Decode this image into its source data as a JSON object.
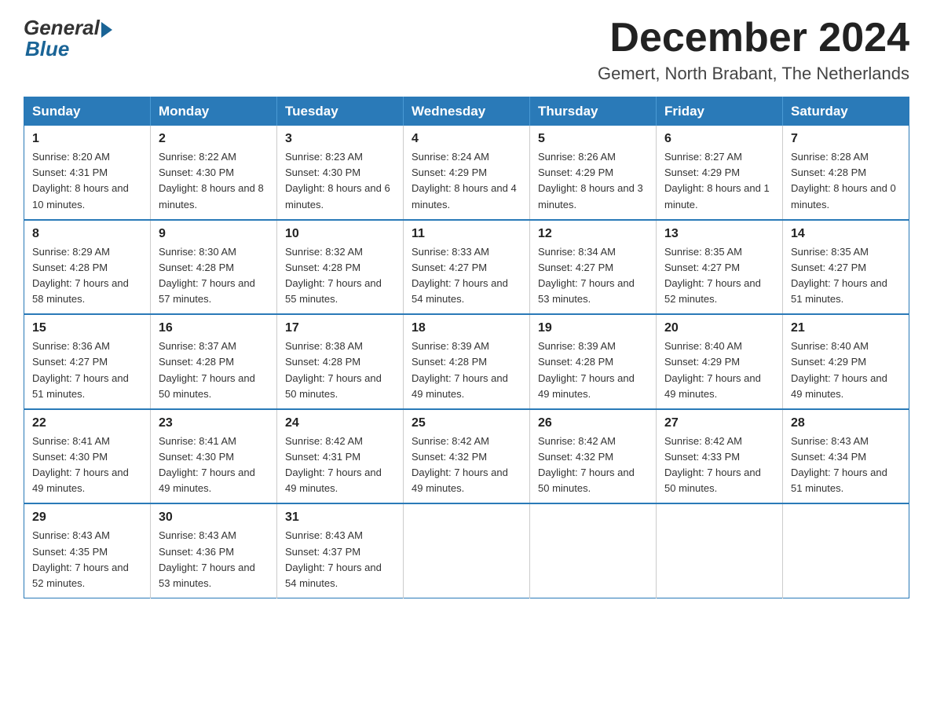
{
  "logo": {
    "general": "General",
    "blue": "Blue"
  },
  "header": {
    "month_year": "December 2024",
    "location": "Gemert, North Brabant, The Netherlands"
  },
  "weekdays": [
    "Sunday",
    "Monday",
    "Tuesday",
    "Wednesday",
    "Thursday",
    "Friday",
    "Saturday"
  ],
  "weeks": [
    [
      {
        "day": "1",
        "sunrise": "8:20 AM",
        "sunset": "4:31 PM",
        "daylight": "8 hours and 10 minutes."
      },
      {
        "day": "2",
        "sunrise": "8:22 AM",
        "sunset": "4:30 PM",
        "daylight": "8 hours and 8 minutes."
      },
      {
        "day": "3",
        "sunrise": "8:23 AM",
        "sunset": "4:30 PM",
        "daylight": "8 hours and 6 minutes."
      },
      {
        "day": "4",
        "sunrise": "8:24 AM",
        "sunset": "4:29 PM",
        "daylight": "8 hours and 4 minutes."
      },
      {
        "day": "5",
        "sunrise": "8:26 AM",
        "sunset": "4:29 PM",
        "daylight": "8 hours and 3 minutes."
      },
      {
        "day": "6",
        "sunrise": "8:27 AM",
        "sunset": "4:29 PM",
        "daylight": "8 hours and 1 minute."
      },
      {
        "day": "7",
        "sunrise": "8:28 AM",
        "sunset": "4:28 PM",
        "daylight": "8 hours and 0 minutes."
      }
    ],
    [
      {
        "day": "8",
        "sunrise": "8:29 AM",
        "sunset": "4:28 PM",
        "daylight": "7 hours and 58 minutes."
      },
      {
        "day": "9",
        "sunrise": "8:30 AM",
        "sunset": "4:28 PM",
        "daylight": "7 hours and 57 minutes."
      },
      {
        "day": "10",
        "sunrise": "8:32 AM",
        "sunset": "4:28 PM",
        "daylight": "7 hours and 55 minutes."
      },
      {
        "day": "11",
        "sunrise": "8:33 AM",
        "sunset": "4:27 PM",
        "daylight": "7 hours and 54 minutes."
      },
      {
        "day": "12",
        "sunrise": "8:34 AM",
        "sunset": "4:27 PM",
        "daylight": "7 hours and 53 minutes."
      },
      {
        "day": "13",
        "sunrise": "8:35 AM",
        "sunset": "4:27 PM",
        "daylight": "7 hours and 52 minutes."
      },
      {
        "day": "14",
        "sunrise": "8:35 AM",
        "sunset": "4:27 PM",
        "daylight": "7 hours and 51 minutes."
      }
    ],
    [
      {
        "day": "15",
        "sunrise": "8:36 AM",
        "sunset": "4:27 PM",
        "daylight": "7 hours and 51 minutes."
      },
      {
        "day": "16",
        "sunrise": "8:37 AM",
        "sunset": "4:28 PM",
        "daylight": "7 hours and 50 minutes."
      },
      {
        "day": "17",
        "sunrise": "8:38 AM",
        "sunset": "4:28 PM",
        "daylight": "7 hours and 50 minutes."
      },
      {
        "day": "18",
        "sunrise": "8:39 AM",
        "sunset": "4:28 PM",
        "daylight": "7 hours and 49 minutes."
      },
      {
        "day": "19",
        "sunrise": "8:39 AM",
        "sunset": "4:28 PM",
        "daylight": "7 hours and 49 minutes."
      },
      {
        "day": "20",
        "sunrise": "8:40 AM",
        "sunset": "4:29 PM",
        "daylight": "7 hours and 49 minutes."
      },
      {
        "day": "21",
        "sunrise": "8:40 AM",
        "sunset": "4:29 PM",
        "daylight": "7 hours and 49 minutes."
      }
    ],
    [
      {
        "day": "22",
        "sunrise": "8:41 AM",
        "sunset": "4:30 PM",
        "daylight": "7 hours and 49 minutes."
      },
      {
        "day": "23",
        "sunrise": "8:41 AM",
        "sunset": "4:30 PM",
        "daylight": "7 hours and 49 minutes."
      },
      {
        "day": "24",
        "sunrise": "8:42 AM",
        "sunset": "4:31 PM",
        "daylight": "7 hours and 49 minutes."
      },
      {
        "day": "25",
        "sunrise": "8:42 AM",
        "sunset": "4:32 PM",
        "daylight": "7 hours and 49 minutes."
      },
      {
        "day": "26",
        "sunrise": "8:42 AM",
        "sunset": "4:32 PM",
        "daylight": "7 hours and 50 minutes."
      },
      {
        "day": "27",
        "sunrise": "8:42 AM",
        "sunset": "4:33 PM",
        "daylight": "7 hours and 50 minutes."
      },
      {
        "day": "28",
        "sunrise": "8:43 AM",
        "sunset": "4:34 PM",
        "daylight": "7 hours and 51 minutes."
      }
    ],
    [
      {
        "day": "29",
        "sunrise": "8:43 AM",
        "sunset": "4:35 PM",
        "daylight": "7 hours and 52 minutes."
      },
      {
        "day": "30",
        "sunrise": "8:43 AM",
        "sunset": "4:36 PM",
        "daylight": "7 hours and 53 minutes."
      },
      {
        "day": "31",
        "sunrise": "8:43 AM",
        "sunset": "4:37 PM",
        "daylight": "7 hours and 54 minutes."
      },
      null,
      null,
      null,
      null
    ]
  ]
}
